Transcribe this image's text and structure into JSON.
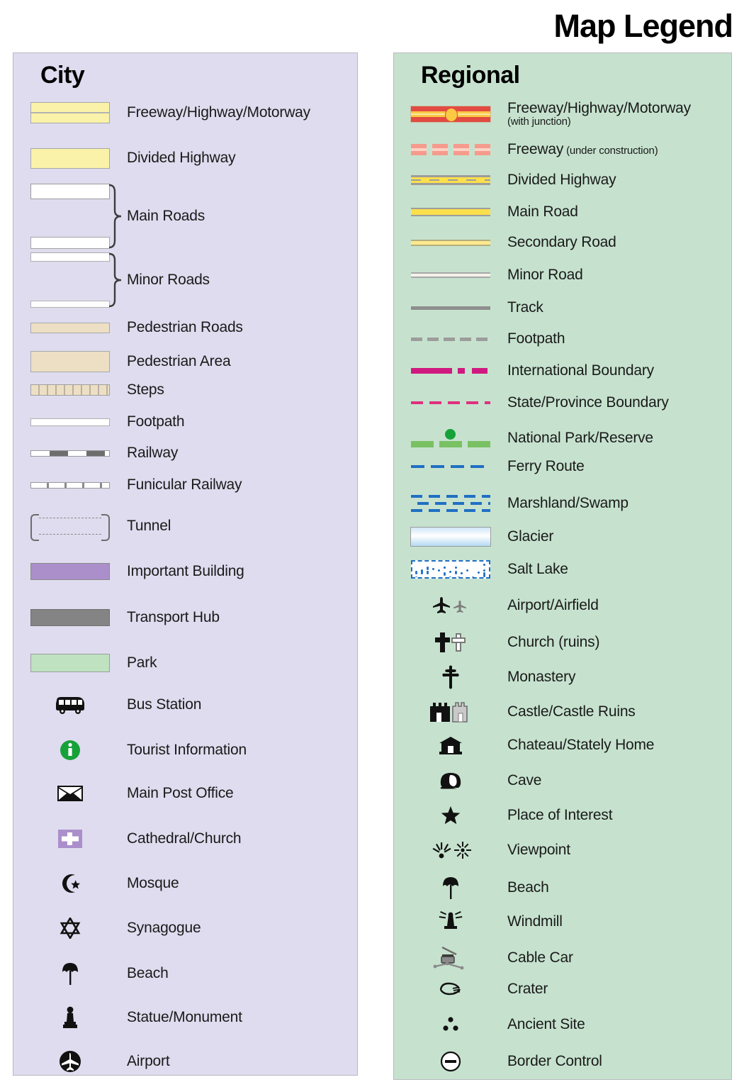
{
  "title": "Map Legend",
  "city": {
    "heading": "City",
    "items": [
      {
        "label": "Freeway/Highway/Motorway",
        "symbol": "freeway-divided-band"
      },
      {
        "label": "Divided Highway",
        "symbol": "divided-highway-band"
      },
      {
        "label": "Main Roads",
        "symbol": "main-roads-bracketed-pair"
      },
      {
        "label": "Minor Roads",
        "symbol": "minor-roads-bracketed-pair"
      },
      {
        "label": "Pedestrian Roads",
        "symbol": "pedestrian-road-band"
      },
      {
        "label": "Pedestrian Area",
        "symbol": "pedestrian-area-block"
      },
      {
        "label": "Steps",
        "symbol": "steps-hatched-band"
      },
      {
        "label": "Footpath",
        "symbol": "footpath-thin-band"
      },
      {
        "label": "Railway",
        "symbol": "railway-dashed-band"
      },
      {
        "label": "Funicular Railway",
        "symbol": "funicular-ticked-band"
      },
      {
        "label": "Tunnel",
        "symbol": "tunnel-bracket-dashed"
      },
      {
        "label": "Important Building",
        "symbol": "important-building-swatch"
      },
      {
        "label": "Transport Hub",
        "symbol": "transport-hub-swatch"
      },
      {
        "label": "Park",
        "symbol": "park-swatch"
      },
      {
        "label": "Bus Station",
        "symbol": "bus-icon"
      },
      {
        "label": "Tourist Information",
        "symbol": "information-icon"
      },
      {
        "label": "Main Post Office",
        "symbol": "envelope-icon"
      },
      {
        "label": "Cathedral/Church",
        "symbol": "church-cross-box-icon"
      },
      {
        "label": "Mosque",
        "symbol": "star-and-crescent-icon"
      },
      {
        "label": "Synagogue",
        "symbol": "star-of-david-icon"
      },
      {
        "label": "Beach",
        "symbol": "beach-umbrella-icon"
      },
      {
        "label": "Statue/Monument",
        "symbol": "statue-icon"
      },
      {
        "label": "Airport",
        "symbol": "airport-circle-icon"
      }
    ]
  },
  "regional": {
    "heading": "Regional",
    "items": [
      {
        "label": "Freeway/Highway/Motorway",
        "sublabel": "(with junction)",
        "sub_block": true,
        "symbol": "regional-freeway-junction"
      },
      {
        "label": "Freeway",
        "sublabel": "(under construction)",
        "symbol": "freeway-under-construction"
      },
      {
        "label": "Divided Highway",
        "symbol": "regional-divided-highway"
      },
      {
        "label": "Main Road",
        "symbol": "regional-main-road"
      },
      {
        "label": "Secondary Road",
        "symbol": "regional-secondary-road"
      },
      {
        "label": "Minor Road",
        "symbol": "regional-minor-road"
      },
      {
        "label": "Track",
        "symbol": "track-line"
      },
      {
        "label": "Footpath",
        "symbol": "footpath-dashed-line"
      },
      {
        "label": "International Boundary",
        "symbol": "international-boundary-line"
      },
      {
        "label": "State/Province Boundary",
        "symbol": "state-boundary-line"
      },
      {
        "label": "National Park/Reserve",
        "symbol": "national-park-line"
      },
      {
        "label": "Ferry Route",
        "symbol": "ferry-route-line"
      },
      {
        "label": "Marshland/Swamp",
        "symbol": "marshland-pattern"
      },
      {
        "label": "Glacier",
        "symbol": "glacier-swatch"
      },
      {
        "label": "Salt Lake",
        "symbol": "salt-lake-swatch"
      },
      {
        "label": "Airport/Airfield",
        "symbol": "airplane-pair-icon"
      },
      {
        "label": "Church (ruins)",
        "symbol": "cross-pair-icon"
      },
      {
        "label": "Monastery",
        "symbol": "monastery-cross-icon"
      },
      {
        "label": "Castle/Castle Ruins",
        "symbol": "castle-pair-icon"
      },
      {
        "label": "Chateau/Stately Home",
        "symbol": "chateau-icon"
      },
      {
        "label": "Cave",
        "symbol": "cave-icon"
      },
      {
        "label": "Place of Interest",
        "symbol": "star-icon"
      },
      {
        "label": "Viewpoint",
        "symbol": "viewpoint-pair-icon"
      },
      {
        "label": "Beach",
        "symbol": "beach-umbrella-icon"
      },
      {
        "label": "Windmill",
        "symbol": "windmill-icon"
      },
      {
        "label": "Cable Car",
        "symbol": "cable-car-icon"
      },
      {
        "label": "Crater",
        "symbol": "crater-icon"
      },
      {
        "label": "Ancient Site",
        "symbol": "ancient-site-icon"
      },
      {
        "label": "Border Control",
        "symbol": "border-control-icon"
      }
    ]
  },
  "colors": {
    "city_panel_bg": "#dedcee",
    "regional_panel_bg": "#c6e2ce",
    "highway_yellow": "#faf2a8",
    "pedestrian_tan": "#eddfc4",
    "important_building_purple": "#ab8fcb",
    "transport_hub_gray": "#848484",
    "park_green": "#bfe2c0",
    "freeway_red": "#e14b41",
    "junction_yellow": "#fbc942",
    "boundary_magenta": "#d0197f",
    "ferry_blue": "#1f6fc4",
    "national_park_green": "#79c163",
    "info_green": "#17a139"
  }
}
